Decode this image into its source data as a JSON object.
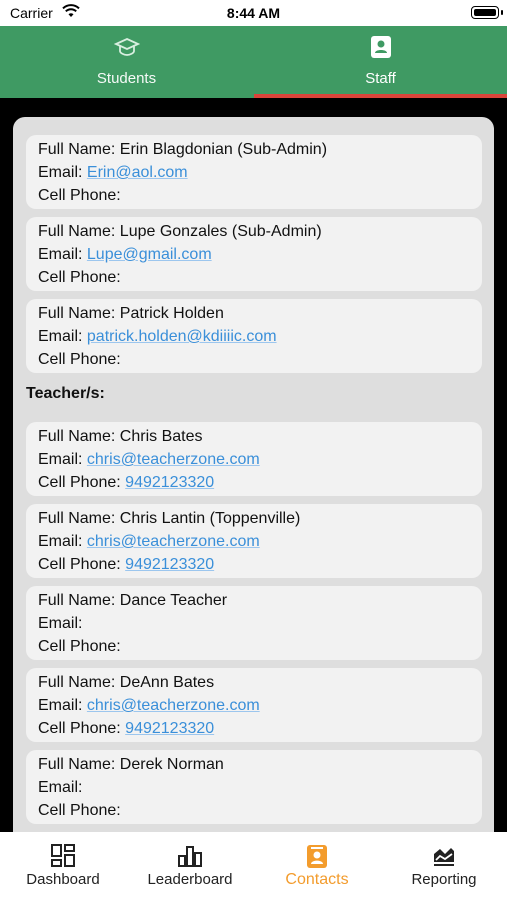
{
  "status_bar": {
    "carrier": "Carrier",
    "time": "8:44 AM"
  },
  "top_tabs": [
    {
      "label": "Students",
      "icon": "graduation-cap-icon"
    },
    {
      "label": "Staff",
      "icon": "contacts-book-icon",
      "active": true
    }
  ],
  "admins": [
    {
      "name_label": "Full Name: Erin Blagdonian (Sub-Admin)",
      "email_prefix": "Email: ",
      "email": "Erin@aol.com",
      "phone_prefix": "Cell Phone: ",
      "phone": ""
    },
    {
      "name_label": "Full Name: Lupe Gonzales (Sub-Admin)",
      "email_prefix": "Email: ",
      "email": "Lupe@gmail.com",
      "phone_prefix": "Cell Phone: ",
      "phone": ""
    },
    {
      "name_label": "Full Name: Patrick Holden",
      "email_prefix": "Email: ",
      "email": "patrick.holden@kdiiiic.com",
      "phone_prefix": "Cell Phone: ",
      "phone": ""
    }
  ],
  "teachers_heading": "Teacher/s:",
  "teachers": [
    {
      "name_label": "Full Name: Chris Bates",
      "email_prefix": "Email: ",
      "email": "chris@teacherzone.com",
      "phone_prefix": "Cell Phone: ",
      "phone": "9492123320"
    },
    {
      "name_label": "Full Name: Chris Lantin (Toppenville)",
      "email_prefix": "Email: ",
      "email": "chris@teacherzone.com",
      "phone_prefix": "Cell Phone: ",
      "phone": "9492123320"
    },
    {
      "name_label": "Full Name: Dance Teacher",
      "email_prefix": "Email:",
      "email": "",
      "phone_prefix": "Cell Phone:",
      "phone": ""
    },
    {
      "name_label": "Full Name: DeAnn Bates",
      "email_prefix": "Email: ",
      "email": "chris@teacherzone.com",
      "phone_prefix": "Cell Phone: ",
      "phone": "9492123320"
    },
    {
      "name_label": "Full Name: Derek Norman",
      "email_prefix": "Email:",
      "email": "",
      "phone_prefix": "Cell Phone:",
      "phone": ""
    }
  ],
  "bottom_nav": [
    {
      "label": "Dashboard",
      "icon": "dashboard-grid-icon"
    },
    {
      "label": "Leaderboard",
      "icon": "bar-chart-icon"
    },
    {
      "label": "Contacts",
      "icon": "contacts-book-icon",
      "active": true
    },
    {
      "label": "Reporting",
      "icon": "reporting-icon"
    }
  ],
  "colors": {
    "header_green": "#3f9a63",
    "tab_underline": "#d9443a",
    "link_blue": "#3a8fd9",
    "active_orange": "#f39c2d"
  }
}
